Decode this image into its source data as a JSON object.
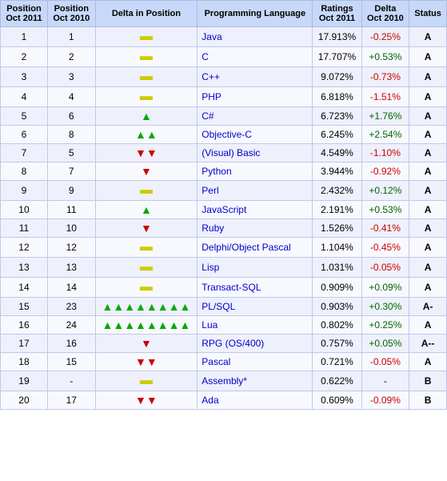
{
  "table": {
    "headers": [
      {
        "label": "Position\nOct 2011",
        "sub": "Oct 2011"
      },
      {
        "label": "Position\nOct 2010",
        "sub": "Oct 2010"
      },
      {
        "label": "Delta in Position"
      },
      {
        "label": "Programming Language"
      },
      {
        "label": "Ratings\nOct 2011",
        "sub": "Oct 2011"
      },
      {
        "label": "Delta\nOct 2010",
        "sub": "Oct 2010"
      },
      {
        "label": "Status"
      }
    ],
    "rows": [
      {
        "pos2011": "1",
        "pos2010": "1",
        "delta": "=",
        "lang": "Java",
        "rating": "17.913%",
        "deltaRating": "-0.25%",
        "drSign": "neg",
        "status": "A"
      },
      {
        "pos2011": "2",
        "pos2010": "2",
        "delta": "=",
        "lang": "C",
        "rating": "17.707%",
        "deltaRating": "+0.53%",
        "drSign": "pos",
        "status": "A"
      },
      {
        "pos2011": "3",
        "pos2010": "3",
        "delta": "=",
        "lang": "C++",
        "rating": "9.072%",
        "deltaRating": "-0.73%",
        "drSign": "neg",
        "status": "A"
      },
      {
        "pos2011": "4",
        "pos2010": "4",
        "delta": "=",
        "lang": "PHP",
        "rating": "6.818%",
        "deltaRating": "-1.51%",
        "drSign": "neg",
        "status": "A"
      },
      {
        "pos2011": "5",
        "pos2010": "6",
        "delta": "up1",
        "lang": "C#",
        "rating": "6.723%",
        "deltaRating": "+1.76%",
        "drSign": "pos",
        "status": "A"
      },
      {
        "pos2011": "6",
        "pos2010": "8",
        "delta": "up2",
        "lang": "Objective-C",
        "rating": "6.245%",
        "deltaRating": "+2.54%",
        "drSign": "pos",
        "status": "A"
      },
      {
        "pos2011": "7",
        "pos2010": "5",
        "delta": "down2",
        "lang": "(Visual) Basic",
        "rating": "4.549%",
        "deltaRating": "-1.10%",
        "drSign": "neg",
        "status": "A"
      },
      {
        "pos2011": "8",
        "pos2010": "7",
        "delta": "down1",
        "lang": "Python",
        "rating": "3.944%",
        "deltaRating": "-0.92%",
        "drSign": "neg",
        "status": "A"
      },
      {
        "pos2011": "9",
        "pos2010": "9",
        "delta": "=",
        "lang": "Perl",
        "rating": "2.432%",
        "deltaRating": "+0.12%",
        "drSign": "pos",
        "status": "A"
      },
      {
        "pos2011": "10",
        "pos2010": "11",
        "delta": "up1",
        "lang": "JavaScript",
        "rating": "2.191%",
        "deltaRating": "+0.53%",
        "drSign": "pos",
        "status": "A"
      },
      {
        "pos2011": "11",
        "pos2010": "10",
        "delta": "down1",
        "lang": "Ruby",
        "rating": "1.526%",
        "deltaRating": "-0.41%",
        "drSign": "neg",
        "status": "A"
      },
      {
        "pos2011": "12",
        "pos2010": "12",
        "delta": "=",
        "lang": "Delphi/Object Pascal",
        "rating": "1.104%",
        "deltaRating": "-0.45%",
        "drSign": "neg",
        "status": "A"
      },
      {
        "pos2011": "13",
        "pos2010": "13",
        "delta": "=",
        "lang": "Lisp",
        "rating": "1.031%",
        "deltaRating": "-0.05%",
        "drSign": "neg",
        "status": "A"
      },
      {
        "pos2011": "14",
        "pos2010": "14",
        "delta": "=",
        "lang": "Transact-SQL",
        "rating": "0.909%",
        "deltaRating": "+0.09%",
        "drSign": "pos",
        "status": "A"
      },
      {
        "pos2011": "15",
        "pos2010": "23",
        "delta": "up8",
        "lang": "PL/SQL",
        "rating": "0.903%",
        "deltaRating": "+0.30%",
        "drSign": "pos",
        "status": "A-"
      },
      {
        "pos2011": "16",
        "pos2010": "24",
        "delta": "up8",
        "lang": "Lua",
        "rating": "0.802%",
        "deltaRating": "+0.25%",
        "drSign": "pos",
        "status": "A"
      },
      {
        "pos2011": "17",
        "pos2010": "16",
        "delta": "down1",
        "lang": "RPG (OS/400)",
        "rating": "0.757%",
        "deltaRating": "+0.05%",
        "drSign": "pos",
        "status": "A--"
      },
      {
        "pos2011": "18",
        "pos2010": "15",
        "delta": "down2",
        "lang": "Pascal",
        "rating": "0.721%",
        "deltaRating": "-0.05%",
        "drSign": "neg",
        "status": "A"
      },
      {
        "pos2011": "19",
        "pos2010": "-",
        "delta": "=",
        "lang": "Assembly*",
        "rating": "0.622%",
        "deltaRating": "-",
        "drSign": "neu",
        "status": "B"
      },
      {
        "pos2011": "20",
        "pos2010": "17",
        "delta": "down2",
        "lang": "Ada",
        "rating": "0.609%",
        "deltaRating": "-0.09%",
        "drSign": "neg",
        "status": "B"
      }
    ]
  }
}
